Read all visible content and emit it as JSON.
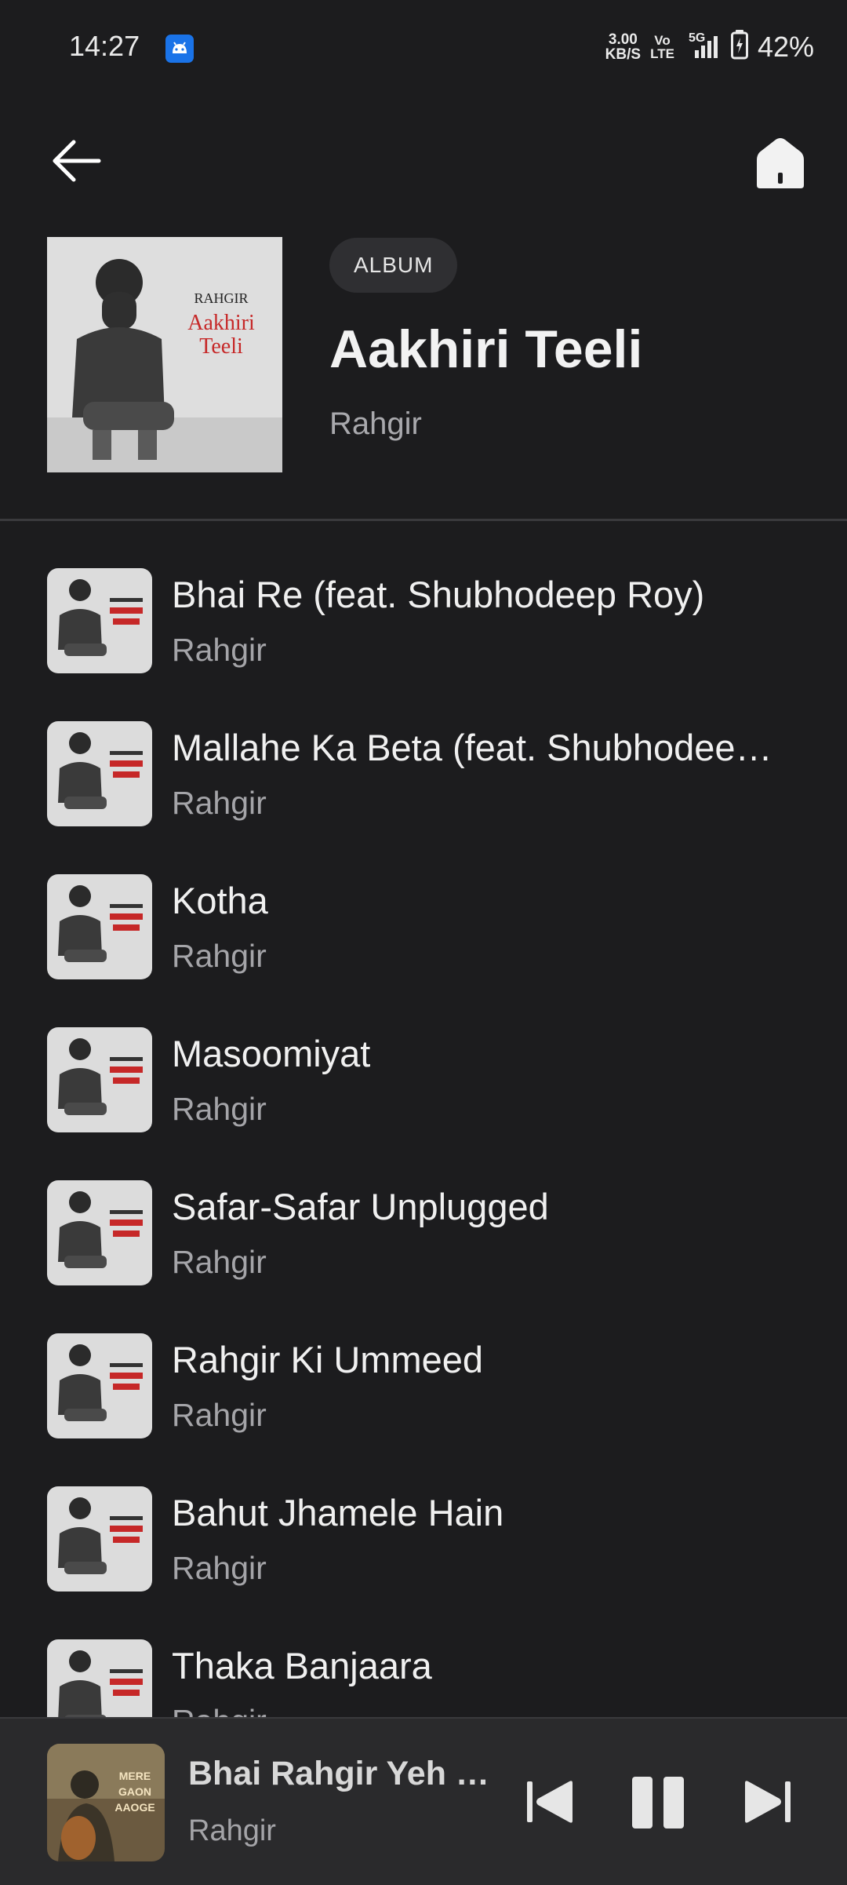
{
  "status_bar": {
    "time": "14:27",
    "net_speed_value": "3.00",
    "net_speed_unit": "KB/S",
    "volte_top": "Vo",
    "volte_bottom": "LTE",
    "network": "5G",
    "battery": "42%"
  },
  "header": {
    "back_icon": "arrow-left-icon",
    "home_icon": "home-icon"
  },
  "album": {
    "badge": "ALBUM",
    "title": "Aakhiri Teeli",
    "artist": "Rahgir",
    "art_text": {
      "artist": "RAHGIR",
      "title_line1": "Aakhiri",
      "title_line2": "Teeli"
    }
  },
  "tracks": [
    {
      "title": "Bhai Re (feat. Shubhodeep Roy)",
      "artist": "Rahgir"
    },
    {
      "title": "Mallahe Ka Beta (feat. Shubhodeep Roy)",
      "artist": "Rahgir"
    },
    {
      "title": "Kotha",
      "artist": "Rahgir"
    },
    {
      "title": "Masoomiyat",
      "artist": "Rahgir"
    },
    {
      "title": "Safar-Safar Unplugged",
      "artist": "Rahgir"
    },
    {
      "title": "Rahgir Ki Ummeed",
      "artist": "Rahgir"
    },
    {
      "title": "Bahut Jhamele Hain",
      "artist": "Rahgir"
    },
    {
      "title": "Thaka Banjaara",
      "artist": "Rahgir"
    }
  ],
  "now_playing": {
    "title": "Bhai Rahgir Yeh Kya Kar Diya",
    "artist": "Rahgir",
    "art_text": [
      "MERE",
      "GAON",
      "AAOGE"
    ],
    "controls": [
      "skip-previous-icon",
      "pause-icon",
      "skip-next-icon"
    ]
  },
  "colors": {
    "background": "#1c1c1e",
    "player_background": "#2a2a2c",
    "primary_text": "#f0f0f0",
    "secondary_text": "#a4a4a8",
    "art_accent": "#c62828"
  }
}
